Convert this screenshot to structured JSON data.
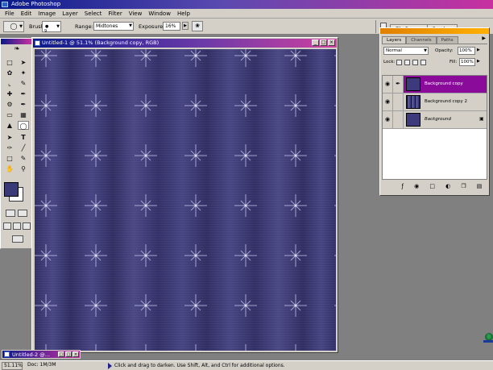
{
  "app": {
    "title": "Adobe Photoshop"
  },
  "menu": [
    "File",
    "Edit",
    "Image",
    "Layer",
    "Select",
    "Filter",
    "View",
    "Window",
    "Help"
  ],
  "options_bar": {
    "brush_label": "Brush:",
    "brush_size": "9",
    "range_label": "Range:",
    "range_value": "Midtones",
    "exposure_label": "Exposure:",
    "exposure_value": "16%",
    "dock_tabs": [
      "File Browser",
      "Brushes"
    ]
  },
  "document": {
    "title": "Untitled-1 @ 51.1% (Background copy, RGB)"
  },
  "colors": {
    "foreground": "#3a3a78",
    "background": "#ffffff",
    "canvas": "#3d3a7c",
    "selected_layer": "#8a0a9a"
  },
  "layers_panel": {
    "tabs": [
      "Layers",
      "Channels",
      "Paths"
    ],
    "blend_mode": "Normal",
    "opacity_label": "Opacity:",
    "opacity_value": "100%",
    "lock_label": "Lock:",
    "fill_label": "Fill:",
    "fill_value": "100%",
    "layers": [
      {
        "name": "Background copy",
        "visible": true,
        "selected": true,
        "locked": false
      },
      {
        "name": "Background copy 2",
        "visible": true,
        "selected": false,
        "locked": false
      },
      {
        "name": "Background",
        "visible": true,
        "selected": false,
        "locked": true
      }
    ],
    "footer_icons": [
      "layer-style-icon",
      "mask-icon",
      "new-set-icon",
      "adjustment-layer-icon",
      "new-layer-icon",
      "trash-icon"
    ]
  },
  "minimized_window": {
    "title": "Untitled-2 @..."
  },
  "status_bar": {
    "zoom": "51.11%",
    "doc_info": "Doc: 1M/3M",
    "hint": "Click and drag to darken. Use Shift, Alt, and Ctrl for additional options."
  }
}
